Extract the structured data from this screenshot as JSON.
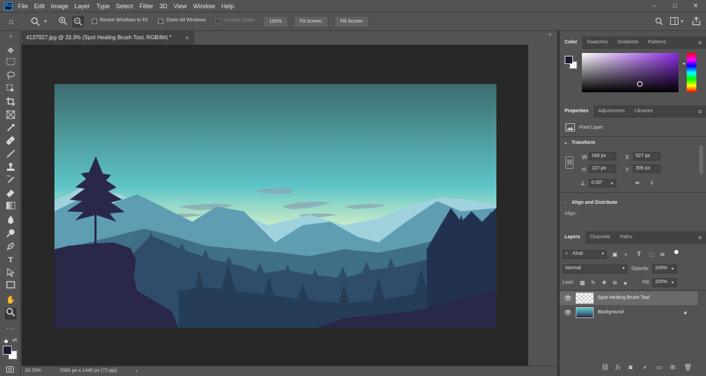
{
  "app": {
    "logo": "Ps"
  },
  "menu": [
    "File",
    "Edit",
    "Image",
    "Layer",
    "Type",
    "Select",
    "Filter",
    "3D",
    "View",
    "Window",
    "Help"
  ],
  "window_controls": [
    "–",
    "□",
    "✕"
  ],
  "options": {
    "resize_windows_label": "Resize Windows to Fit",
    "zoom_all_windows_label": "Zoom All Windows",
    "scrubby_zoom_label": "Scrubby Zoom",
    "zoom_value": "100%",
    "fit_screen_label": "Fit Screen",
    "fill_screen_label": "Fill Screen"
  },
  "document": {
    "tab_title": "4137927.jpg @ 33.3% (Spot Healing Brush Tool, RGB/8#) *",
    "close_glyph": "×",
    "zoom": "33.33%",
    "dimensions": "2560 px x 1440 px (72 ppi)"
  },
  "color_panel": {
    "tabs": [
      "Color",
      "Swatches",
      "Gradients",
      "Patterns"
    ],
    "foreground": "#1c1a33",
    "background": "#ffffff"
  },
  "properties": {
    "tabs": [
      "Properties",
      "Adjustments",
      "Libraries"
    ],
    "layer_type": "Pixel Layer",
    "transform_label": "Transform",
    "w_label": "W",
    "w_value": "168 px",
    "h_label": "H",
    "h_value": "137 px",
    "x_label": "X",
    "x_value": "527 px",
    "y_label": "Y",
    "y_value": "306 px",
    "angle_value": "0.00°",
    "align_label": "Align and Distribute",
    "align_sub": "Align:"
  },
  "layers": {
    "tabs": [
      "Layers",
      "Channels",
      "Paths"
    ],
    "filter_kind": "Kind",
    "blend_mode": "Normal",
    "opacity_label": "Opacity:",
    "opacity_value": "100%",
    "lock_label": "Lock:",
    "fill_label": "Fill:",
    "fill_value": "100%",
    "items": [
      {
        "name": "Spot Healing Brush Tool",
        "selected": true
      },
      {
        "name": "Background",
        "italic": true,
        "locked": true
      }
    ]
  },
  "colors": {
    "sky_top": "#3d6b6f",
    "sky_mid": "#5ec5c7",
    "sky_horizon": "#e6f6c9",
    "mountain_far": "#9fd2dd",
    "mountain_mid": "#5f9db2",
    "hills": "#3f6f86",
    "forest": "#2f4d6a",
    "foreground": "#2a2848"
  }
}
